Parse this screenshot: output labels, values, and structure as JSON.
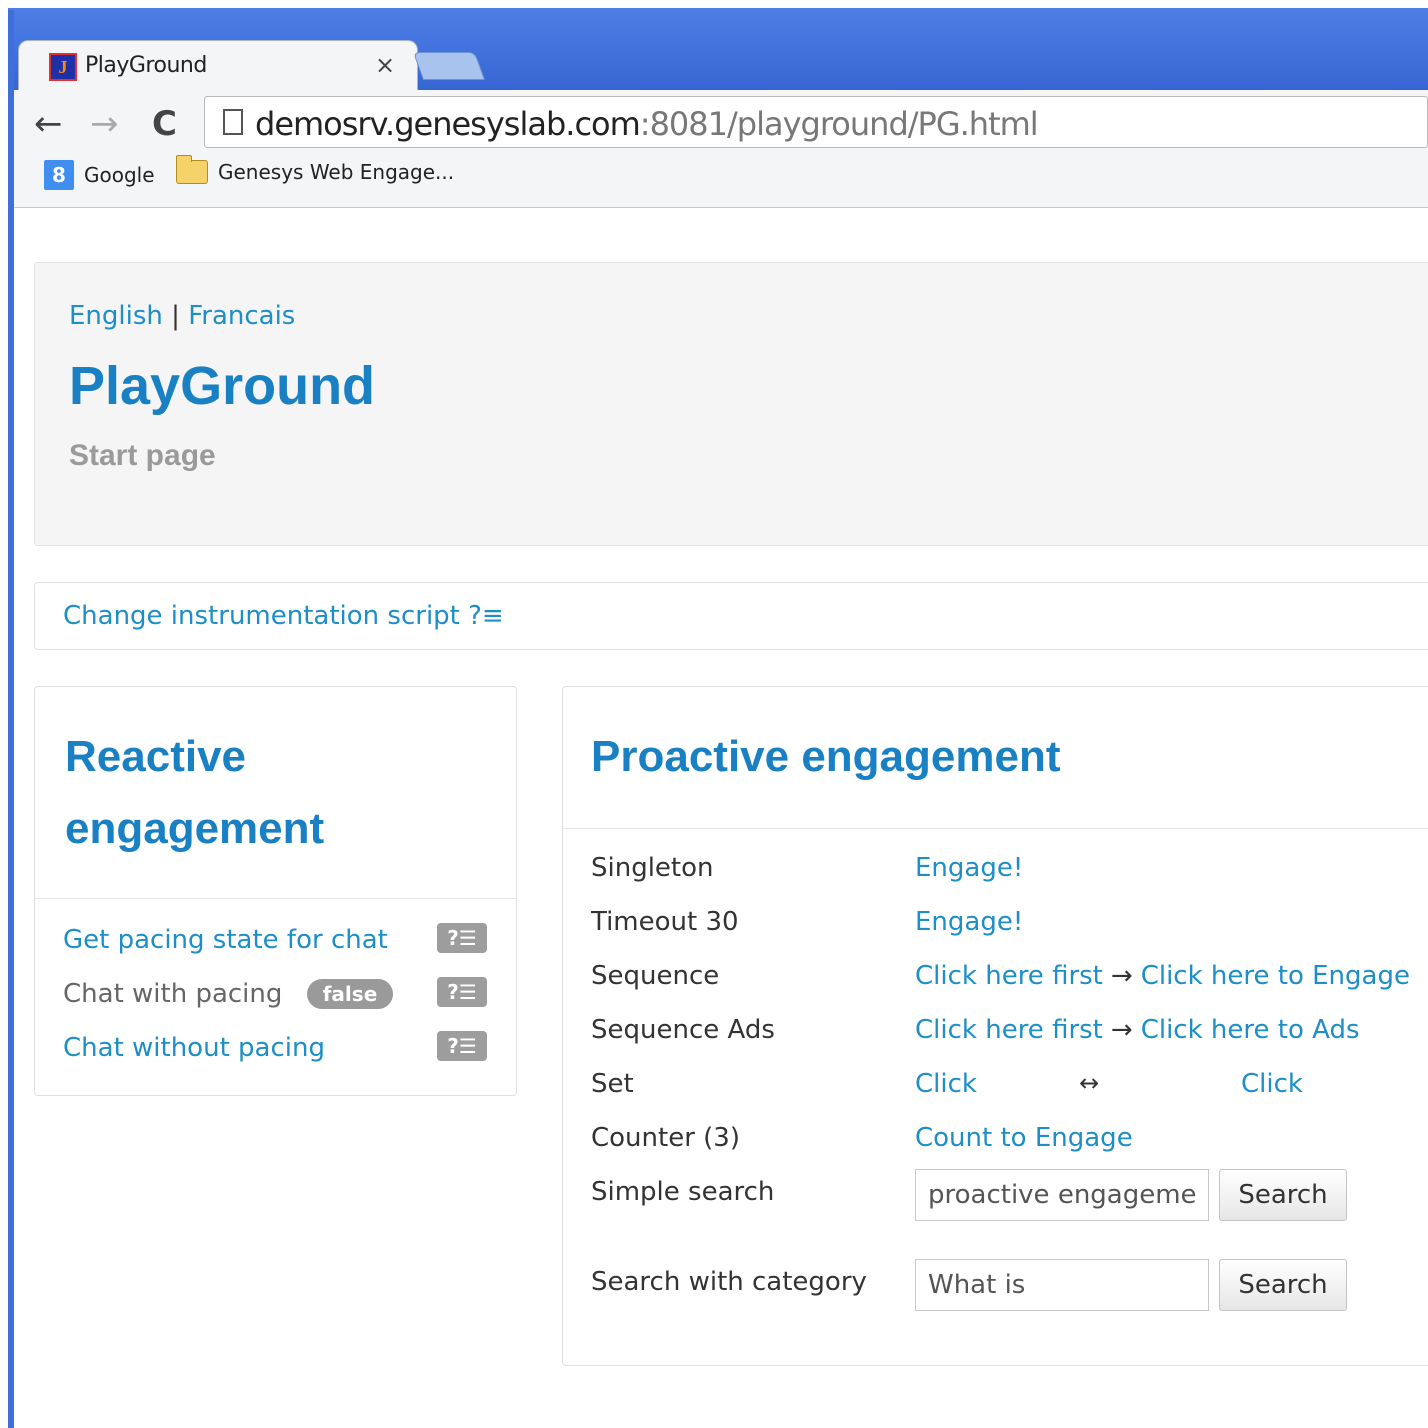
{
  "browser": {
    "tab_title": "PlayGround",
    "tab_close": "×",
    "url_host": "demosrv.genesyslab.com",
    "url_path": ":8081/playground/PG.html",
    "nav": {
      "back": "←",
      "forward": "→",
      "reload": "C"
    },
    "bookmarks": [
      {
        "label": "Google",
        "icon": "google-icon",
        "icon_glyph": "8"
      },
      {
        "label": "Genesys Web Engage...",
        "icon": "folder-icon"
      }
    ]
  },
  "hero": {
    "lang_english": "English",
    "lang_separator": "|",
    "lang_french": "Francais",
    "title": "PlayGround",
    "subtitle": "Start page"
  },
  "instrumentation": {
    "link": "Change instrumentation script ?≡"
  },
  "reactive": {
    "title": "Reactive engagement",
    "items": [
      {
        "label": "Get pacing state for chat",
        "help": "?☰"
      },
      {
        "label": "Chat with pacing",
        "badge": "false",
        "help": "?☰"
      },
      {
        "label": "Chat without pacing",
        "help": "?☰"
      }
    ]
  },
  "proactive": {
    "title": "Proactive engagement",
    "rows": [
      {
        "label": "Singleton",
        "action": "Engage!"
      },
      {
        "label": "Timeout 30",
        "action": "Engage!"
      },
      {
        "label": "Sequence",
        "first": "Click here first",
        "arrow": "→",
        "second": "Click here to Engage"
      },
      {
        "label": "Sequence Ads",
        "first": "Click here first",
        "arrow": "→",
        "second": "Click here to Ads"
      },
      {
        "label": "Set",
        "first": "Click",
        "arrow": "↔",
        "second": "Click"
      },
      {
        "label": "Counter (3)",
        "action": "Count to Engage"
      },
      {
        "label": "Simple search",
        "input_value": "proactive engagement",
        "button": "Search"
      },
      {
        "label": "Search with category",
        "input_value": "What is",
        "button": "Search"
      }
    ]
  },
  "colors": {
    "link": "#1d8ec8",
    "title": "#1880c3",
    "chrome": "#3f6fd8"
  }
}
